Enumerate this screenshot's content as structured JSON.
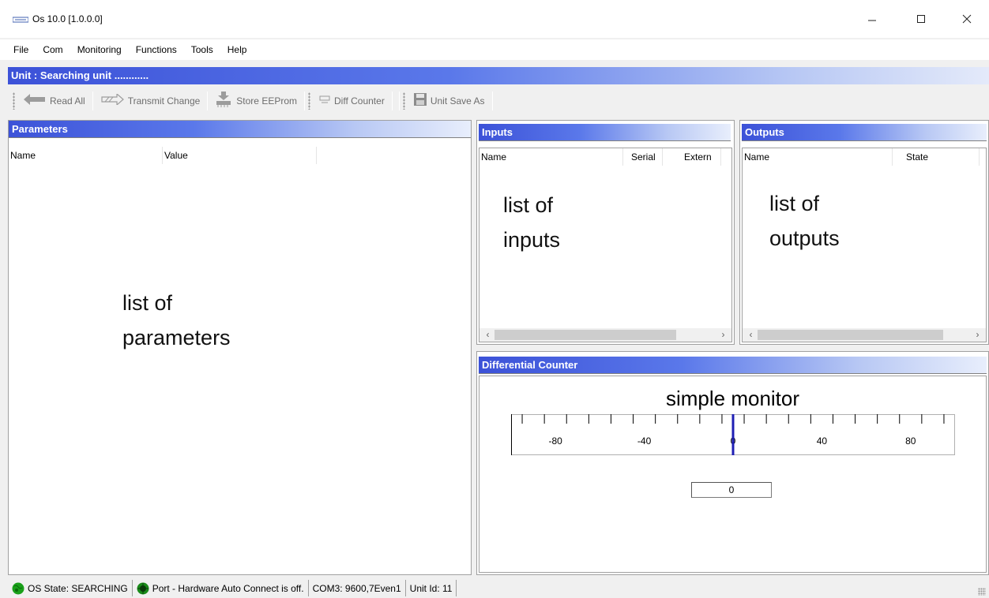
{
  "window": {
    "title": "Os 10.0 [1.0.0.0]",
    "icon": "app-logo-icon",
    "minimize": "—",
    "maximize": "☐",
    "close": "✕"
  },
  "menu": [
    "File",
    "Com",
    "Monitoring",
    "Functions",
    "Tools",
    "Help"
  ],
  "unit_header": "Unit : Searching unit ............",
  "toolbar": {
    "read_all": "Read All",
    "transmit_change": "Transmit Change",
    "store_eeprom": "Store EEProm",
    "diff_counter": "Diff Counter",
    "unit_save_as": "Unit Save As"
  },
  "parameters": {
    "title": "Parameters",
    "columns": [
      "Name",
      "Value"
    ],
    "placeholder": "list of\nparameters"
  },
  "inputs": {
    "title": "Inputs",
    "columns": [
      "Name",
      "Serial",
      "Extern"
    ],
    "placeholder": "list of\ninputs"
  },
  "outputs": {
    "title": "Outputs",
    "columns": [
      "Name",
      "State"
    ],
    "placeholder": "list of\noutputs"
  },
  "diff_counter": {
    "title": "Differential Counter",
    "caption": "simple monitor",
    "scale_labels": [
      "-80",
      "-40",
      "0",
      "40",
      "80"
    ],
    "scale_min": -100,
    "scale_max": 100,
    "needle_value": 0,
    "indicator_color": "#1f1fb4",
    "value": "0"
  },
  "status": {
    "os_state": "OS State: SEARCHING",
    "port": "Port - Hardware Auto Connect is off.",
    "com": "COM3: 9600,7Even1",
    "unit_id": "Unit Id: 11"
  },
  "colors": {
    "header_blue": "#3c52d8",
    "status_green": "#1aa01a"
  }
}
